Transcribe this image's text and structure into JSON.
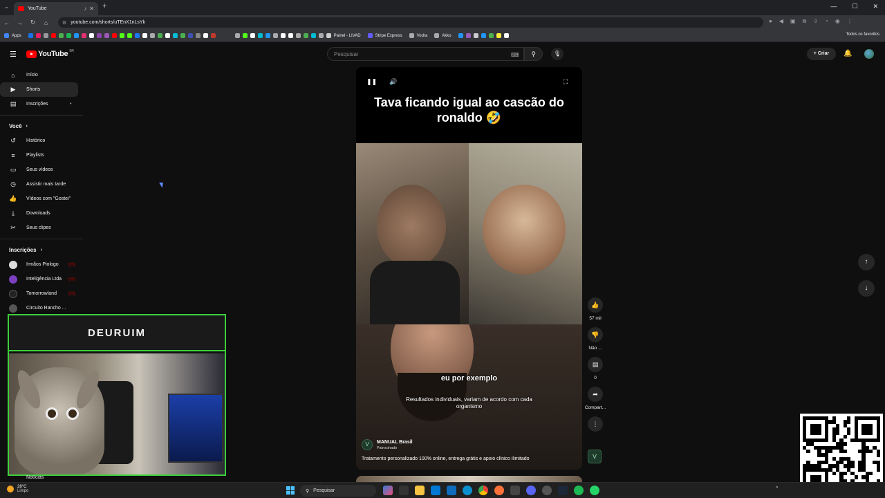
{
  "browser": {
    "tab_title": "YouTube",
    "url": "youtube.com/shorts/uTEnX1nLsYk",
    "bookmarks_apps": "Apps",
    "bookmarks": [
      "Painel - LIVAD",
      "Stripe Express",
      "Vodra",
      "Akko"
    ],
    "bookmarks_all": "Todos os favoritos"
  },
  "header": {
    "logo": "YouTube",
    "logo_region": "BR",
    "search_placeholder": "Pesquisar",
    "create_label": "Criar"
  },
  "sidebar": {
    "main": [
      {
        "label": "Início",
        "icon": "home-icon"
      },
      {
        "label": "Shorts",
        "icon": "shorts-icon"
      },
      {
        "label": "Inscrições",
        "icon": "subscriptions-icon"
      }
    ],
    "you_section": "Você",
    "you_items": [
      {
        "label": "Histórico",
        "icon": "history-icon"
      },
      {
        "label": "Playlists",
        "icon": "playlist-icon"
      },
      {
        "label": "Seus vídeos",
        "icon": "video-icon"
      },
      {
        "label": "Assistir mais tarde",
        "icon": "clock-icon"
      },
      {
        "label": "Vídeos com \"Gostei\"",
        "icon": "like-icon"
      },
      {
        "label": "Downloads",
        "icon": "download-icon"
      },
      {
        "label": "Seus clipes",
        "icon": "scissors-icon"
      }
    ],
    "subs_section": "Inscrições",
    "channels": [
      {
        "label": "Irmãos Piologo",
        "color": "#ddd"
      },
      {
        "label": "Inteligência Ltda",
        "color": "#7b3fbf"
      },
      {
        "label": "Tomorrowland",
        "color": "#222"
      },
      {
        "label": "Circuito Rancho ...",
        "color": "#555"
      }
    ],
    "noticias": "Notícias"
  },
  "overlay": {
    "streamer_name": "DEURUIM"
  },
  "video": {
    "title": "Tava ficando igual ao cascão do ronaldo 🤣",
    "subtitle": "eu por exemplo",
    "disclaimer": "Resultados individuais, variam de acordo com cada organismo",
    "sponsor_name": "MANUAL Brasil",
    "sponsor_tag": "Patrocinado",
    "sponsor_desc": "Tratamento personalizado 100% online, entrega grátis e apoio clínico ilimitado"
  },
  "actions": {
    "likes": "57 mil",
    "dislike": "Não ...",
    "comments": "0",
    "share": "Compart..."
  },
  "taskbar": {
    "temp": "28°C",
    "condition": "Limpo",
    "search": "Pesquisar"
  }
}
